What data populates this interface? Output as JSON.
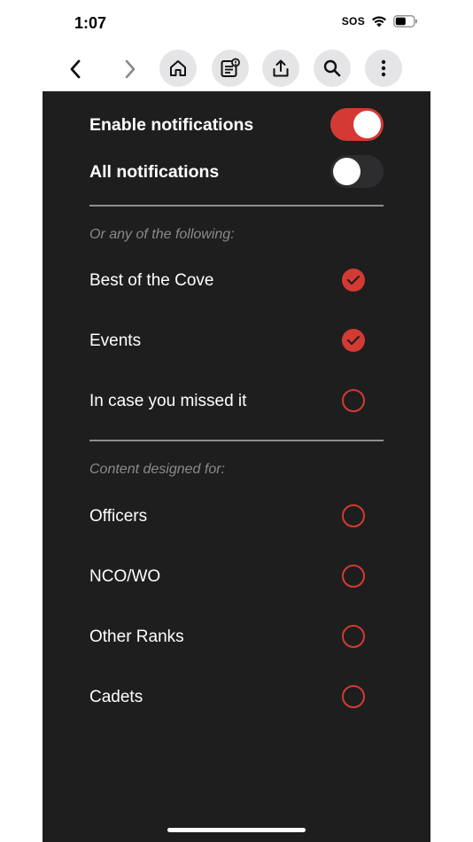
{
  "status_bar": {
    "time": "1:07",
    "sos": "SOS"
  },
  "toolbar": {
    "buttons": [
      "back-arrow",
      "forward-arrow",
      "home-icon",
      "news-icon",
      "share-icon",
      "search-icon",
      "more-icon"
    ]
  },
  "settings": {
    "enable_notifications": {
      "label": "Enable notifications",
      "on": true
    },
    "all_notifications": {
      "label": "All notifications",
      "on": false
    },
    "section1_caption": "Or any of the following:",
    "section1_items": [
      {
        "label": "Best of the Cove",
        "checked": true
      },
      {
        "label": "Events",
        "checked": true
      },
      {
        "label": "In case you missed it",
        "checked": false
      }
    ],
    "section2_caption": "Content designed for:",
    "section2_items": [
      {
        "label": "Officers",
        "checked": false
      },
      {
        "label": "NCO/WO",
        "checked": false
      },
      {
        "label": "Other Ranks",
        "checked": false
      },
      {
        "label": "Cadets",
        "checked": false
      }
    ]
  },
  "colors": {
    "accent": "#d33a33",
    "panel_bg": "#1e1e1e",
    "toolbar_button_bg": "#e5e5e7"
  }
}
